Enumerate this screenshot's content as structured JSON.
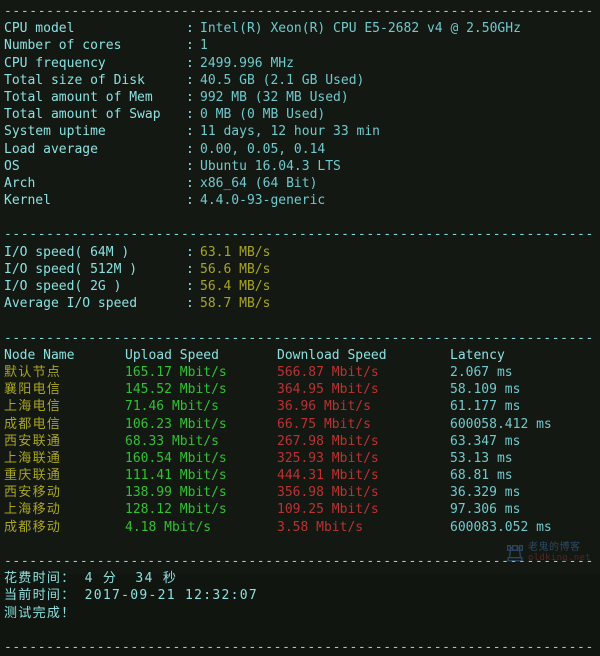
{
  "terminal": {
    "background": "#141812",
    "separator_char": "-",
    "separator_width": 73,
    "colors": {
      "label": "#8ae0e0",
      "value": "#6fc9cd",
      "io_value": "#a9a520",
      "node_name": "#a9a520",
      "upload": "#30c130",
      "download": "#bc3232",
      "latency": "#6fc9cd",
      "separator": "#7fd8d8"
    }
  },
  "separators": {
    "line": "-------------------------------------------------------------------------"
  },
  "system_info": {
    "colon": ":",
    "rows": [
      {
        "label": "CPU model",
        "value": "Intel(R) Xeon(R) CPU E5-2682 v4 @ 2.50GHz"
      },
      {
        "label": "Number of cores",
        "value": "1"
      },
      {
        "label": "CPU frequency",
        "value": "2499.996 MHz"
      },
      {
        "label": "Total size of Disk",
        "value": "40.5 GB (2.1 GB Used)"
      },
      {
        "label": "Total amount of Mem",
        "value": "992 MB (32 MB Used)"
      },
      {
        "label": "Total amount of Swap",
        "value": "0 MB (0 MB Used)"
      },
      {
        "label": "System uptime",
        "value": "11 days, 12 hour 33 min"
      },
      {
        "label": "Load average",
        "value": "0.00, 0.05, 0.14"
      },
      {
        "label": "OS",
        "value": "Ubuntu 16.04.3 LTS"
      },
      {
        "label": "Arch",
        "value": "x86_64 (64 Bit)"
      },
      {
        "label": "Kernel",
        "value": "4.4.0-93-generic"
      }
    ]
  },
  "io_speed": {
    "colon": ":",
    "rows": [
      {
        "label": "I/O speed( 64M )",
        "value": "63.1 MB/s"
      },
      {
        "label": "I/O speed( 512M )",
        "value": "56.6 MB/s"
      },
      {
        "label": "I/O speed( 2G )",
        "value": "56.4 MB/s"
      },
      {
        "label": "Average I/O speed",
        "value": "58.7 MB/s"
      }
    ]
  },
  "node_table": {
    "headers": {
      "node": "Node Name",
      "upload": "Upload Speed",
      "download": "Download Speed",
      "latency": "Latency"
    },
    "rows": [
      {
        "node": "默认节点",
        "upload": "165.17 Mbit/s",
        "download": "566.87 Mbit/s",
        "latency": "2.067 ms"
      },
      {
        "node": "襄阳电信",
        "upload": "145.52 Mbit/s",
        "download": "364.95 Mbit/s",
        "latency": "58.109 ms"
      },
      {
        "node": "上海电信",
        "upload": "71.46 Mbit/s",
        "download": "36.96 Mbit/s",
        "latency": "61.177 ms"
      },
      {
        "node": "成都电信",
        "upload": "106.23 Mbit/s",
        "download": "66.75 Mbit/s",
        "latency": "600058.412 ms"
      },
      {
        "node": "西安联通",
        "upload": "68.33 Mbit/s",
        "download": "267.98 Mbit/s",
        "latency": "63.347 ms"
      },
      {
        "node": "上海联通",
        "upload": "160.54 Mbit/s",
        "download": "325.93 Mbit/s",
        "latency": "53.13 ms"
      },
      {
        "node": "重庆联通",
        "upload": "111.41 Mbit/s",
        "download": "444.31 Mbit/s",
        "latency": "68.81 ms"
      },
      {
        "node": "西安移动",
        "upload": "138.99 Mbit/s",
        "download": "356.98 Mbit/s",
        "latency": "36.329 ms"
      },
      {
        "node": "上海移动",
        "upload": "128.12 Mbit/s",
        "download": "109.25 Mbit/s",
        "latency": "97.306 ms"
      },
      {
        "node": "成都移动",
        "upload": "4.18 Mbit/s",
        "download": "3.58 Mbit/s",
        "latency": "600083.052 ms"
      }
    ]
  },
  "footer": {
    "elapsed": "花费时间： 4 分  34 秒",
    "current_time": "当前时间： 2017-09-21 12:32:07",
    "status": "测试完成！"
  },
  "watermark": {
    "cn_text": "老鬼的博客",
    "url_text": "oldking.net",
    "logo": "crown-rook-icon"
  }
}
